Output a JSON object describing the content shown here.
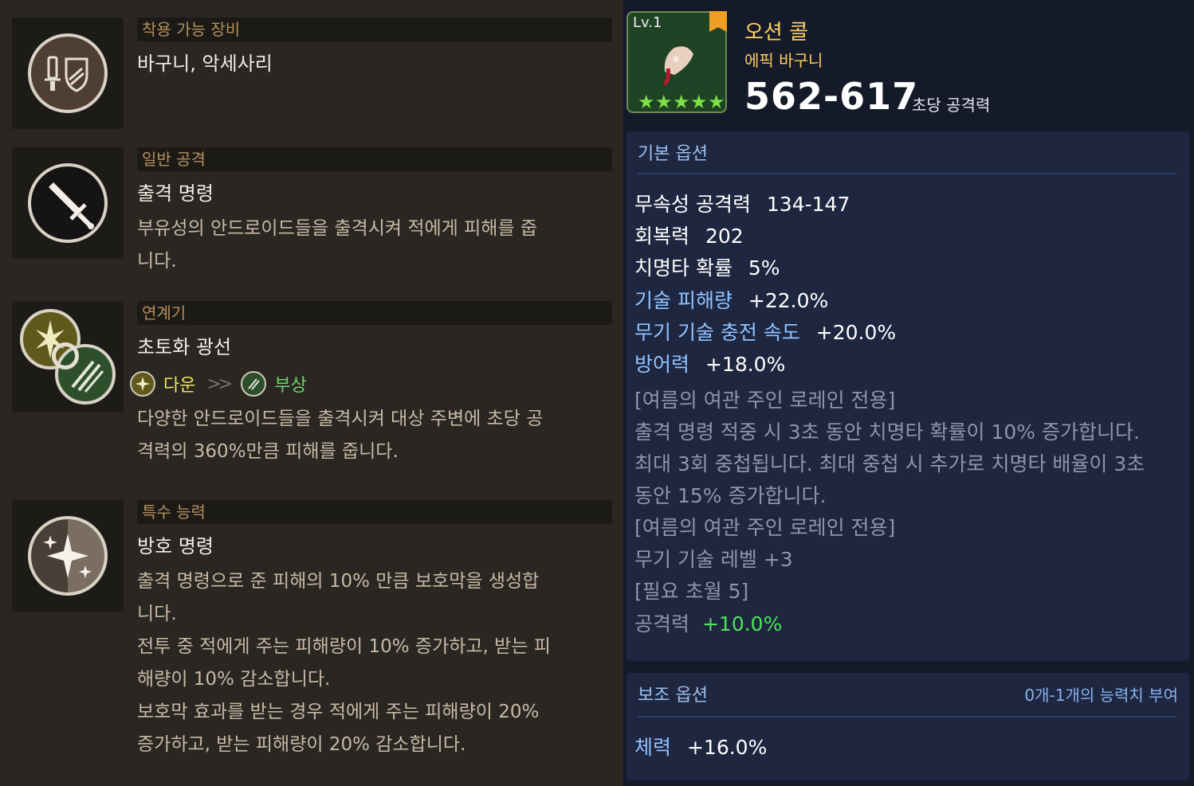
{
  "sections": [
    {
      "header": "착용 가능 장비",
      "title": "바구니, 악세사리",
      "icon": "equipment-icon"
    },
    {
      "header": "일반 공격",
      "title": "출격 명령",
      "description": [
        "부유성의 안드로이드들을 출격시켜 적에게 피해를 줍",
        "니다."
      ],
      "icon": "sword-icon"
    },
    {
      "header": "연계기",
      "title": "초토화 광선",
      "combo": {
        "from": "다운",
        "to": "부상"
      },
      "description": [
        "다양한 안드로이드들을 출격시켜 대상 주변에 초당 공",
        "격력의 360%만큼 피해를 줍니다."
      ],
      "icon": "chain-combo-icon"
    },
    {
      "header": "특수 능력",
      "title": "방호 명령",
      "description": [
        "출격 명령으로 준 피해의 10% 만큼 보호막을 생성합",
        "니다.",
        "전투 중 적에게 주는 피해량이 10% 증가하고, 받는 피",
        "해량이 10% 감소합니다.",
        "보호막 효과를 받는 경우 적에게 주는 피해량이 20%",
        "증가하고, 받는 피해량이 20% 감소합니다."
      ],
      "icon": "sparkle-icon"
    }
  ],
  "item": {
    "level": "Lv.1",
    "name": "오션 콜",
    "type": "에픽 바구니",
    "attack": "562-617",
    "attack_label": "초당 공격력",
    "stars": 5
  },
  "basic_options": {
    "header": "기본 옵션",
    "stats": [
      {
        "key": "무속성 공격력",
        "value": "134-147",
        "highlight": false
      },
      {
        "key": "회복력",
        "value": "202",
        "highlight": false
      },
      {
        "key": "치명타 확률",
        "value": "5%",
        "highlight": false
      },
      {
        "key": "기술 피해량",
        "value": "+22.0%",
        "highlight": true
      },
      {
        "key": "무기 기술 충전 속도",
        "value": "+20.0%",
        "highlight": true
      },
      {
        "key": "방어력",
        "value": "+18.0%",
        "highlight": true
      }
    ],
    "notes": [
      "[여름의 여관 주인 로레인 전용]",
      "출격 명령 적중 시 3초 동안 치명타 확률이 10% 증가합니다.",
      "최대 3회 중첩됩니다. 최대 중첩 시 추가로 치명타 배율이 3초",
      "동안 15% 증가합니다.",
      "[여름의 여관 주인 로레인 전용]",
      "무기 기술 레벨 +3",
      "[필요 초월 5]"
    ],
    "final": {
      "key": "공격력",
      "value": "+10.0%"
    }
  },
  "sub_options": {
    "header": "보조 옵션",
    "info": "0개-1개의 능력치 부여",
    "stats": [
      {
        "key": "체력",
        "value": "+16.0%"
      }
    ]
  }
}
